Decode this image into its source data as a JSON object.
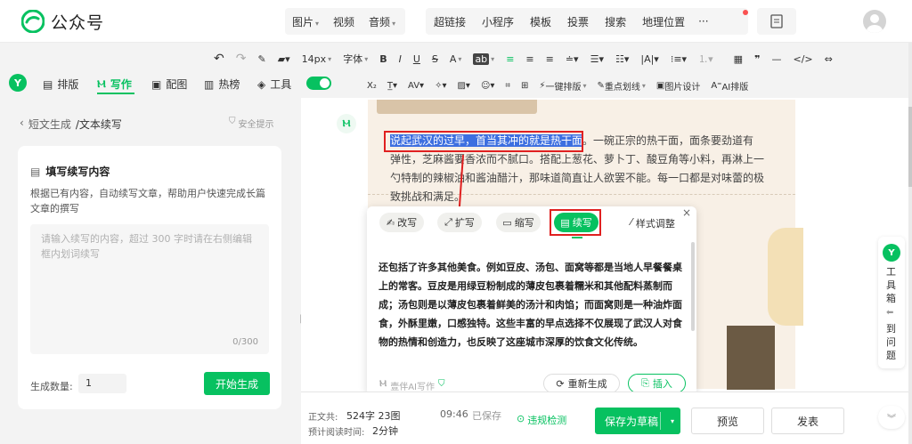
{
  "app": {
    "name": "公众号"
  },
  "insert_menu": {
    "items": [
      {
        "label": "图片",
        "caret": true
      },
      {
        "label": "视频",
        "caret": false
      },
      {
        "label": "音频",
        "caret": true
      }
    ]
  },
  "insert_menu2": {
    "items": [
      "超链接",
      "小程序",
      "模板",
      "投票",
      "搜索",
      "地理位置"
    ],
    "more": "···"
  },
  "format_toolbar": {
    "font_size": "14px",
    "font_family": "字体",
    "items": [
      "B",
      "I",
      "U",
      "S",
      "A",
      "ab"
    ]
  },
  "mode_tabs": {
    "items": [
      {
        "label": "排版",
        "icon": "layout-icon",
        "active": false
      },
      {
        "label": "写作",
        "icon": "ai-write-icon",
        "active": true
      },
      {
        "label": "配图",
        "icon": "image-icon",
        "active": false
      },
      {
        "label": "热榜",
        "icon": "hot-icon",
        "active": false
      },
      {
        "label": "工具",
        "icon": "tool-icon",
        "active": false
      }
    ]
  },
  "toolbar2": {
    "oneclick": "一键排版",
    "highlight": "重点划线",
    "image_design": "图片设计",
    "ai_layout": "AI排版"
  },
  "left_panel": {
    "breadcrumb_back": "短文生成",
    "breadcrumb_current": "/文本续写",
    "safety": "安全提示",
    "card_title": "填写续写内容",
    "card_desc": "根据已有内容，自动续写文章，帮助用户快速完成长篇文章的撰写",
    "input_placeholder": "请输入续写的内容，超过 300 字时请在右侧编辑框内划词续写",
    "counter": "0/300",
    "qty_label": "生成数量:",
    "qty_value": "1",
    "generate_button": "开始生成"
  },
  "article": {
    "selected_text": "说起武汉的过早，首当其冲的就是热干面",
    "paragraph_rest": "。一碗正宗的热干面，面条要劲道有弹性，芝麻酱要香浓而不腻口。搭配上葱花、萝卜丁、酸豆角等小料，再淋上一勺特制的辣椒油和酱油醋汁，那味道简直让人欲罢不能。每一口都是对味蕾的极致挑战和满足。"
  },
  "ai_popup": {
    "chips": [
      {
        "label": "改写"
      },
      {
        "label": "扩写"
      },
      {
        "label": "缩写"
      },
      {
        "label": "续写",
        "active": true
      }
    ],
    "style_adjust": "样式调整",
    "generated_text": "还包括了许多其他美食。例如豆皮、汤包、面窝等都是当地人早餐餐桌上的常客。豆皮是用绿豆粉制成的薄皮包裹着糯米和其他配料蒸制而成；汤包则是以薄皮包裹着鲜美的汤汁和肉馅；而面窝则是一种油炸面食，外酥里嫩，口感独特。这些丰富的早点选择不仅展现了武汉人对食物的热情和创造力，也反映了这座城市深厚的饮食文化传统。",
    "brand": "壹伴AI写作",
    "regenerate": "重新生成",
    "insert": "插入"
  },
  "status": {
    "word_count_label": "正文共:",
    "word_count": "524字 23图",
    "read_time_label": "预计阅读时间:",
    "read_time": "2分钟",
    "saved_time": "09:46",
    "saved_label": "已保存",
    "violation_check": "违规检测"
  },
  "actions": {
    "save_draft": "保存为草稿",
    "preview": "预览",
    "publish": "发表"
  },
  "side_toolbox": {
    "label1": "工具箱",
    "label2": "到问题"
  },
  "colors": {
    "brand_green": "#07c160",
    "highlight_red": "#e02020",
    "selection_blue": "#3d6fe0"
  }
}
